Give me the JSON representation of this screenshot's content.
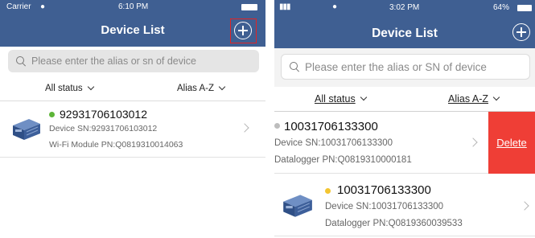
{
  "left": {
    "status_bar": {
      "carrier": "Carrier",
      "time": "6:10 PM"
    },
    "header": {
      "title": "Device List"
    },
    "search": {
      "placeholder": "Please enter the alias or sn of device"
    },
    "filters": {
      "status": "All status",
      "sort": "Alias A-Z"
    },
    "devices": [
      {
        "title": "92931706103012",
        "line1": "Device SN:92931706103012",
        "line2": "Wi-Fi Module PN:Q0819310014063",
        "status_color": "#5db538"
      }
    ]
  },
  "right": {
    "status_bar": {
      "time": "3:02 PM",
      "battery": "64%"
    },
    "header": {
      "title": "Device List"
    },
    "search": {
      "placeholder": "Please enter the alias or SN of device"
    },
    "filters": {
      "status": "All status",
      "sort": "Alias A-Z"
    },
    "devices": [
      {
        "title": "10031706133300",
        "line1": "Device SN:10031706133300",
        "line2": "Datalogger PN:Q0819310000181",
        "status_color": "#bdbdbd"
      },
      {
        "title": "10031706133300",
        "line1": "Device SN:10031706133300",
        "line2": "Datalogger PN:Q0819360039533",
        "status_color": "#f3c531"
      }
    ],
    "delete_label": "Delete"
  },
  "colors": {
    "header": "#3f5f92",
    "delete": "#ef3e36",
    "highlight": "#e12424"
  }
}
